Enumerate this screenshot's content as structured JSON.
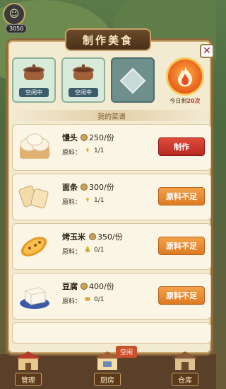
{
  "header": {
    "coins": "3050",
    "title": "制作美食"
  },
  "pots": [
    {
      "status": "空闲中"
    },
    {
      "status": "空闲中"
    }
  ],
  "fire": {
    "today_prefix": "今日剩",
    "today_count": "20次"
  },
  "menu_title": "我的菜谱",
  "ingredient_label": "原料：",
  "recipes": [
    {
      "name": "馒头",
      "price": "250/份",
      "ingredient_count": "1/1",
      "action": "制作",
      "ingredient_icon": "wheat-icon"
    },
    {
      "name": "面条",
      "price": "300/份",
      "ingredient_count": "1/1",
      "action": "原料不足",
      "ingredient_icon": "wheat-icon"
    },
    {
      "name": "烤玉米",
      "price": "350/份",
      "ingredient_count": "0/1",
      "action": "原料不足",
      "ingredient_icon": "corn-icon"
    },
    {
      "name": "豆腐",
      "price": "400/份",
      "ingredient_count": "0/1",
      "action": "原料不足",
      "ingredient_icon": "soybean-icon"
    }
  ],
  "nav": {
    "manage": "管理",
    "kitchen": "厨房",
    "warehouse": "仓库",
    "idle": "空闲"
  },
  "colors": {
    "make_button": "#c0392b",
    "lack_button": "#e8892a",
    "panel_bg": "#f3ead2"
  }
}
